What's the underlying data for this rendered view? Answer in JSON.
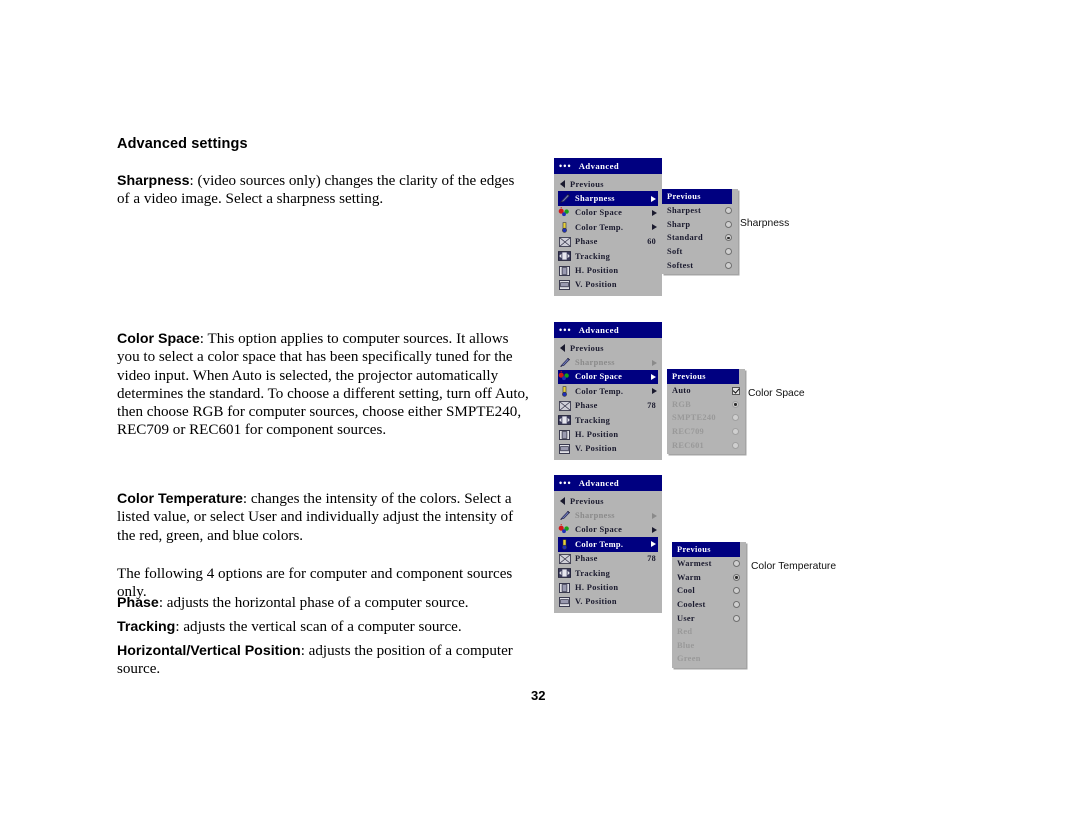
{
  "document": {
    "heading": "Advanced settings",
    "page_number": "32",
    "paragraphs": {
      "sharpness": {
        "term": "Sharpness",
        "body": ": (video sources only) changes the clarity of the edges of a video image. Select a sharpness setting."
      },
      "color_space": {
        "term": "Color Space",
        "body": ": This option applies to computer sources. It allows you to select a color space that has been specifically tuned for the video input. When Auto is selected, the projector automatically determines the standard. To choose a different setting, turn off Auto, then choose RGB for computer sources, choose either SMPTE240, REC709 or REC601 for component sources."
      },
      "color_temperature": {
        "term": "Color Temperature",
        "body": ": changes the intensity of the colors. Select a listed value, or select User and individually adjust the intensity of the red, green, and blue colors."
      },
      "note": {
        "term": "",
        "body": "The following 4 options are for computer and component sources only."
      },
      "phase": {
        "term": "Phase",
        "body": ": adjusts the horizontal phase of a computer source."
      },
      "tracking": {
        "term": "Tracking",
        "body": ": adjusts the vertical scan of a computer source."
      },
      "hv_position": {
        "term": "Horizontal/Vertical Position",
        "body": ": adjusts the position of a computer source."
      }
    }
  },
  "colors": {
    "menu_title_bar": "#000080",
    "menu_background": "#b4b4b4",
    "menu_highlight": "#000080",
    "menu_text": "#1a1a2e",
    "menu_text_disabled": "#8a8a8a"
  },
  "osd_menus": [
    {
      "id": "sharpness-menu",
      "title": "Advanced",
      "callout": "Sharpness",
      "items": [
        {
          "label": "Previous",
          "icon": "back-arrow-icon",
          "state": "normal",
          "arrow": false,
          "value": null
        },
        {
          "label": "Sharpness",
          "icon": "sharpness-icon",
          "state": "selected",
          "arrow": true,
          "value": null
        },
        {
          "label": "Color Space",
          "icon": "color-space-icon",
          "state": "normal",
          "arrow": true,
          "value": null
        },
        {
          "label": "Color Temp.",
          "icon": "color-temp-icon",
          "state": "normal",
          "arrow": true,
          "value": null
        },
        {
          "label": "Phase",
          "icon": "phase-icon",
          "state": "normal",
          "arrow": false,
          "value": "60"
        },
        {
          "label": "Tracking",
          "icon": "tracking-icon",
          "state": "normal",
          "arrow": false,
          "value": null
        },
        {
          "label": "H. Position",
          "icon": "h-position-icon",
          "state": "normal",
          "arrow": false,
          "value": null
        },
        {
          "label": "V. Position",
          "icon": "v-position-icon",
          "state": "normal",
          "arrow": false,
          "value": null
        }
      ],
      "submenu": {
        "header": "Previous",
        "options": [
          {
            "label": "Sharpest",
            "control": "radio",
            "checked": false,
            "state": "normal"
          },
          {
            "label": "Sharp",
            "control": "radio",
            "checked": false,
            "state": "normal"
          },
          {
            "label": "Standard",
            "control": "radio",
            "checked": true,
            "state": "normal"
          },
          {
            "label": "Soft",
            "control": "radio",
            "checked": false,
            "state": "normal"
          },
          {
            "label": "Softest",
            "control": "radio",
            "checked": false,
            "state": "normal"
          }
        ]
      }
    },
    {
      "id": "color-space-menu",
      "title": "Advanced",
      "callout": "Color Space",
      "items": [
        {
          "label": "Previous",
          "icon": "back-arrow-icon",
          "state": "normal",
          "arrow": false,
          "value": null
        },
        {
          "label": "Sharpness",
          "icon": "sharpness-icon",
          "state": "dim",
          "arrow": true,
          "value": null
        },
        {
          "label": "Color Space",
          "icon": "color-space-icon",
          "state": "selected",
          "arrow": true,
          "value": null
        },
        {
          "label": "Color Temp.",
          "icon": "color-temp-icon",
          "state": "normal",
          "arrow": true,
          "value": null
        },
        {
          "label": "Phase",
          "icon": "phase-icon",
          "state": "normal",
          "arrow": false,
          "value": "78"
        },
        {
          "label": "Tracking",
          "icon": "tracking-icon",
          "state": "normal",
          "arrow": false,
          "value": null
        },
        {
          "label": "H. Position",
          "icon": "h-position-icon",
          "state": "normal",
          "arrow": false,
          "value": null
        },
        {
          "label": "V. Position",
          "icon": "v-position-icon",
          "state": "normal",
          "arrow": false,
          "value": null
        }
      ],
      "submenu": {
        "header": "Previous",
        "options": [
          {
            "label": "Auto",
            "control": "checkbox",
            "checked": true,
            "state": "normal"
          },
          {
            "label": "RGB",
            "control": "radio",
            "checked": true,
            "state": "dim"
          },
          {
            "label": "SMPTE240",
            "control": "radio",
            "checked": false,
            "state": "dim"
          },
          {
            "label": "REC709",
            "control": "radio",
            "checked": false,
            "state": "dim"
          },
          {
            "label": "REC601",
            "control": "radio",
            "checked": false,
            "state": "dim"
          }
        ]
      }
    },
    {
      "id": "color-temp-menu",
      "title": "Advanced",
      "callout": "Color Temperature",
      "items": [
        {
          "label": "Previous",
          "icon": "back-arrow-icon",
          "state": "normal",
          "arrow": false,
          "value": null
        },
        {
          "label": "Sharpness",
          "icon": "sharpness-icon",
          "state": "dim",
          "arrow": true,
          "value": null
        },
        {
          "label": "Color Space",
          "icon": "color-space-icon",
          "state": "normal",
          "arrow": true,
          "value": null
        },
        {
          "label": "Color Temp.",
          "icon": "color-temp-icon",
          "state": "selected",
          "arrow": true,
          "value": null
        },
        {
          "label": "Phase",
          "icon": "phase-icon",
          "state": "normal",
          "arrow": false,
          "value": "78"
        },
        {
          "label": "Tracking",
          "icon": "tracking-icon",
          "state": "normal",
          "arrow": false,
          "value": null
        },
        {
          "label": "H. Position",
          "icon": "h-position-icon",
          "state": "normal",
          "arrow": false,
          "value": null
        },
        {
          "label": "V. Position",
          "icon": "v-position-icon",
          "state": "normal",
          "arrow": false,
          "value": null
        }
      ],
      "submenu": {
        "header": "Previous",
        "options": [
          {
            "label": "Warmest",
            "control": "radio",
            "checked": false,
            "state": "normal"
          },
          {
            "label": "Warm",
            "control": "radio",
            "checked": true,
            "state": "normal"
          },
          {
            "label": "Cool",
            "control": "radio",
            "checked": false,
            "state": "normal"
          },
          {
            "label": "Coolest",
            "control": "radio",
            "checked": false,
            "state": "normal"
          },
          {
            "label": "User",
            "control": "radio",
            "checked": false,
            "state": "normal"
          },
          {
            "label": "Red",
            "control": "none",
            "checked": false,
            "state": "dim"
          },
          {
            "label": "Blue",
            "control": "none",
            "checked": false,
            "state": "dim"
          },
          {
            "label": "Green",
            "control": "none",
            "checked": false,
            "state": "dim"
          }
        ]
      }
    }
  ]
}
